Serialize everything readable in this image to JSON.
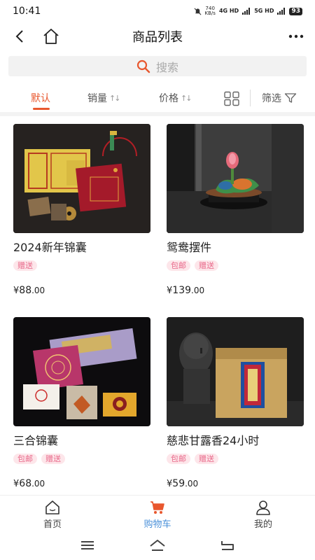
{
  "status": {
    "time": "10:41",
    "speed_value": "740",
    "speed_unit": "KB/s",
    "net1": "4G HD",
    "net2": "5G HD",
    "battery": "93"
  },
  "nav": {
    "title": "商品列表"
  },
  "search": {
    "placeholder": "搜索"
  },
  "sort": {
    "default": "默认",
    "sales": "销量",
    "price": "价格",
    "filter": "筛选",
    "arrows": "↑↓"
  },
  "colors": {
    "accent": "#e8572e",
    "tab_active": "#4a90d9",
    "tag_bg": "#fde6ea",
    "tag_text": "#e8688a"
  },
  "products": [
    {
      "name": "2024新年锦囊",
      "tags": [
        "赠送"
      ],
      "currency": "¥",
      "price_int": "88",
      "price_dec": ".00"
    },
    {
      "name": "鸳鸯摆件",
      "tags": [
        "包邮",
        "赠送"
      ],
      "currency": "¥",
      "price_int": "139",
      "price_dec": ".00"
    },
    {
      "name": "三合锦囊",
      "tags": [
        "包邮",
        "赠送"
      ],
      "currency": "¥",
      "price_int": "68",
      "price_dec": ".00"
    },
    {
      "name": "慈悲甘露香24小时",
      "tags": [
        "包邮",
        "赠送"
      ],
      "currency": "¥",
      "price_int": "59",
      "price_dec": ".00"
    }
  ],
  "tabs": [
    {
      "label": "首页",
      "icon": "home-icon"
    },
    {
      "label": "购物车",
      "icon": "cart-icon"
    },
    {
      "label": "我的",
      "icon": "user-icon"
    }
  ]
}
